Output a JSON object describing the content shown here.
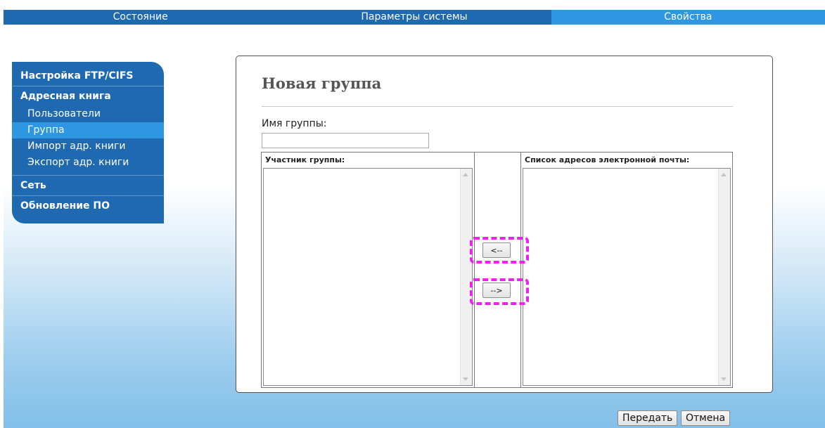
{
  "topnav": {
    "tabs": [
      {
        "label": "Состояние",
        "active": false
      },
      {
        "label": "Параметры системы",
        "active": false
      },
      {
        "label": "Свойства",
        "active": true
      }
    ]
  },
  "sidebar": {
    "ftp_cifs": "Настройка FTP/CIFS",
    "address_book": "Адресная книга",
    "items": [
      {
        "label": "Пользователи",
        "active": false
      },
      {
        "label": "Группа",
        "active": true
      },
      {
        "label": "Импорт адр. книги",
        "active": false
      },
      {
        "label": "Экспорт адр. книги",
        "active": false
      }
    ],
    "network": "Сеть",
    "firmware": "Обновление ПО"
  },
  "form": {
    "title": "Новая группа",
    "group_name_label": "Имя группы:",
    "group_name_value": "",
    "members_header": "Участник группы:",
    "email_list_header": "Список адресов электронной почты:",
    "add_button": "<--",
    "remove_button": "-->"
  },
  "footer": {
    "submit_label": "Передать",
    "cancel_label": "Отмена"
  },
  "colors": {
    "nav_blue": "#1f69b0",
    "active_blue": "#2e97e3",
    "highlight_magenta": "#f020f0"
  }
}
